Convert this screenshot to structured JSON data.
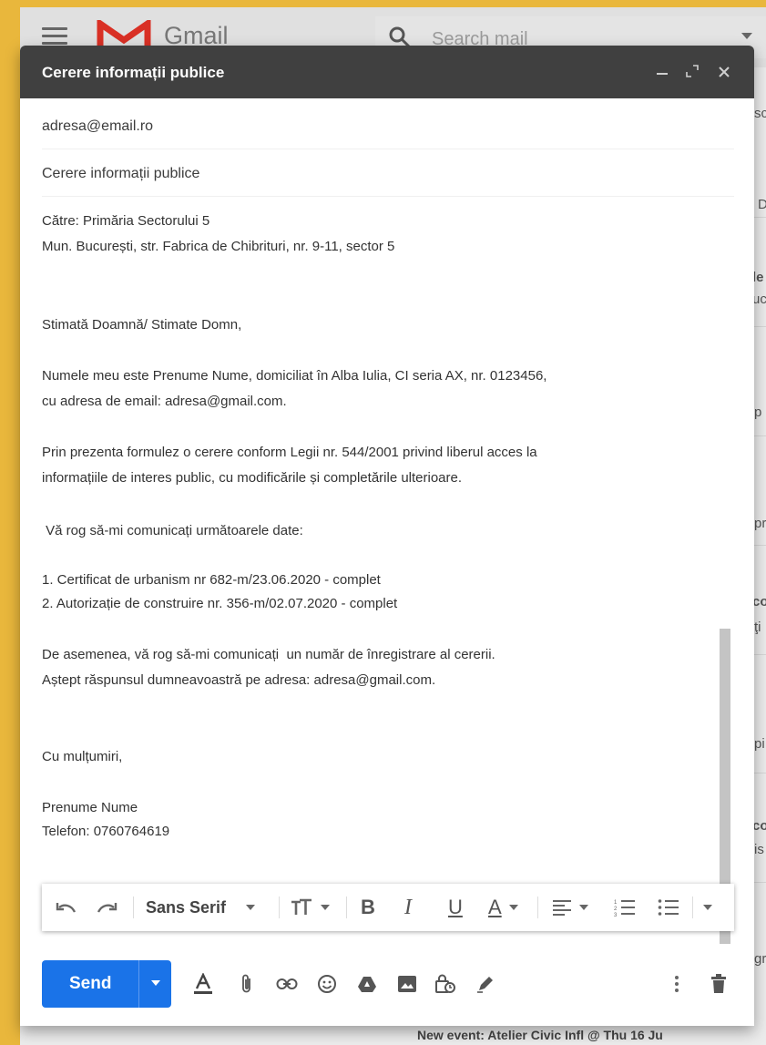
{
  "gmail": {
    "wordmark": "Gmail",
    "search_placeholder": "Search mail",
    "bg_snippets": [
      "sc",
      "D",
      "le",
      "uc",
      "p",
      "pr",
      "co",
      "ţi",
      "pi",
      "co",
      "is",
      "gr"
    ],
    "footer_text": "New event: Atelier Civic Infl @ Thu 16 Ju"
  },
  "compose": {
    "title": "Cerere informații publice",
    "to": "adresa@email.ro",
    "subject": "Cerere informații publice",
    "body_lines": [
      "Către: Primăria Sectorului 5",
      "Mun. București, str. Fabrica de Chibrituri, nr. 9-11, sector 5",
      "Stimată Doamnă/ Stimate Domn,",
      "Numele meu este Prenume Nume, domiciliat în Alba Iulia, CI seria AX, nr. 0123456,",
      "cu adresa de email: adresa@gmail.com.",
      "Prin prezenta formulez o cerere conform Legii nr. 544/2001 privind liberul acces la",
      "informațiile de interes public, cu modificările și completările ulterioare.",
      " Vă rog să-mi comunicați următoarele date:",
      "1. Certificat de urbanism nr 682-m/23.06.2020 - complet",
      "2. Autorizație de construire nr. 356-m/02.07.2020 - complet",
      "De asemenea, vă rog să-mi comunicați  un număr de înregistrare al cererii.",
      "Aștept răspunsul dumneavoastră pe adresa: adresa@gmail.com.",
      "Cu mulțumiri,",
      "Prenume Nume",
      "Telefon: 0760764619"
    ]
  },
  "toolbar": {
    "font_name": "Sans Serif",
    "bold": "B",
    "italic": "I",
    "underline": "U",
    "text_color": "A"
  },
  "send": {
    "label": "Send"
  },
  "colors": {
    "frame": "#e9b73c",
    "titlebar": "#404040",
    "send": "#1a73e8",
    "gmail_red": "#d93025"
  },
  "icons": [
    "menu-icon",
    "gmail-logo-icon",
    "search-icon",
    "minimize-icon",
    "fullscreen-icon",
    "close-icon",
    "undo-icon",
    "redo-icon",
    "text-size-icon",
    "align-icon",
    "numbered-list-icon",
    "bulleted-list-icon",
    "more-formatting-icon",
    "formatting-options-icon",
    "attach-icon",
    "link-icon",
    "emoji-icon",
    "drive-icon",
    "photo-icon",
    "confidential-icon",
    "signature-icon",
    "more-options-icon",
    "trash-icon"
  ]
}
